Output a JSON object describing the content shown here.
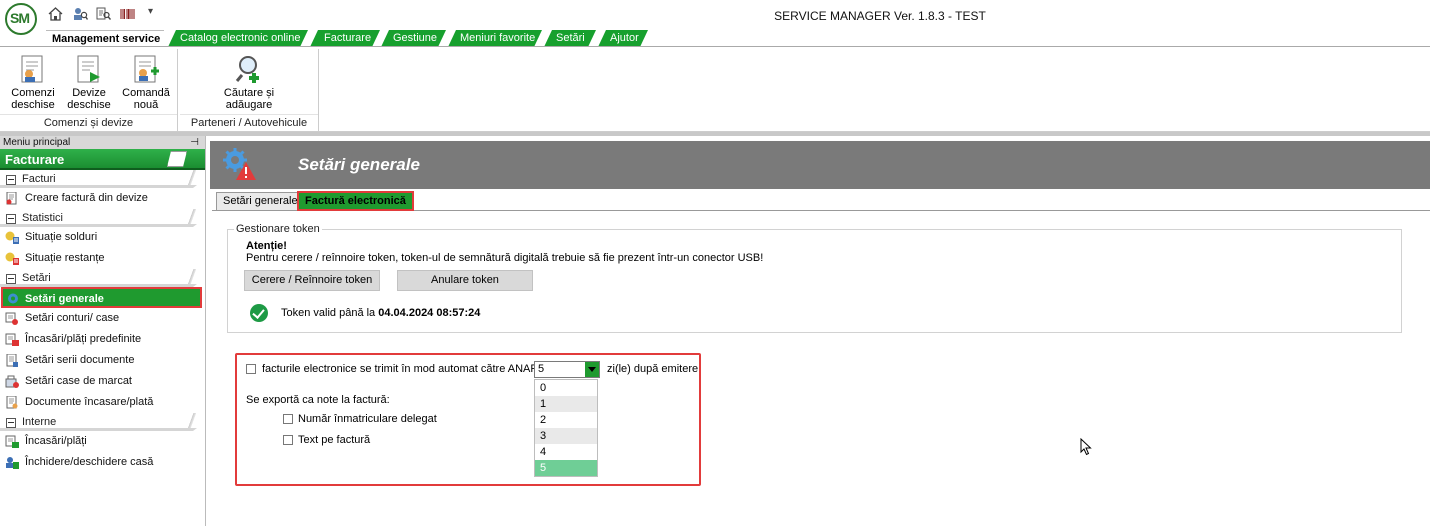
{
  "app": {
    "title": "SERVICE MANAGER Ver. 1.8.3 - TEST",
    "logo_text": "SM",
    "accent_color": "#1f9a2f"
  },
  "quick_access": {
    "icons": [
      "home-icon",
      "search-user-icon",
      "search-document-icon",
      "barcode-icon"
    ],
    "more": "▾"
  },
  "menu_tabs": [
    {
      "label": "Management service",
      "active": true
    },
    {
      "label": "Catalog electronic online",
      "active": false
    },
    {
      "label": "Facturare",
      "active": false
    },
    {
      "label": "Gestiune",
      "active": false
    },
    {
      "label": "Meniuri favorite",
      "active": false
    },
    {
      "label": "Setări",
      "active": false
    },
    {
      "label": "Ajutor",
      "active": false
    }
  ],
  "ribbon": {
    "groups": [
      {
        "label": "Comenzi și devize",
        "buttons": [
          {
            "line1": "Comenzi",
            "line2": "deschise"
          },
          {
            "line1": "Devize",
            "line2": "deschise"
          },
          {
            "line1": "Comandă",
            "line2": "nouă"
          }
        ]
      },
      {
        "label": "Parteneri / Autovehicule",
        "buttons": [
          {
            "line1": "Căutare și",
            "line2": "adăugare"
          }
        ]
      }
    ]
  },
  "left_panel": {
    "header": "Meniu principal",
    "pin": "ᵖ",
    "title": "Facturare",
    "sections": [
      {
        "label": "Facturi",
        "items": [
          "Creare factură din devize"
        ]
      },
      {
        "label": "Statistici",
        "items": [
          "Situație solduri",
          "Situație restanțe"
        ]
      },
      {
        "label": "Setări",
        "items": [
          "Setări generale",
          "Setări conturi/ case",
          "Încasări/plăți predefinite",
          "Setări serii documente",
          "Setări case de marcat",
          "Documente încasare/plată"
        ]
      },
      {
        "label": "Interne",
        "items": [
          "Încasări/plăți",
          "Închidere/deschidere casă"
        ]
      }
    ],
    "selected_item": "Setări generale"
  },
  "main": {
    "header_title": "Setări generale",
    "subtabs": [
      {
        "label": "Setări generale",
        "active": false
      },
      {
        "label": "Factură electronică",
        "active": true
      }
    ],
    "token_group": {
      "legend": "Gestionare token",
      "warning_title": "Atenție!",
      "warning_text": "Pentru cerere / reînnoire token, token-ul de semnătură digitală trebuie să fie prezent într-un conector USB!",
      "request_button": "Cerere / Reînnoire token",
      "cancel_button": "Anulare token",
      "status_prefix": "Token valid până la",
      "status_date": "04.04.2024 08:57:24"
    },
    "auto_send": {
      "checked": false,
      "label": "facturile electronice se trimit în mod automat către ANAF în",
      "days_value": "5",
      "days_suffix": "zi(le) după emitere",
      "options": [
        "0",
        "1",
        "2",
        "3",
        "4",
        "5"
      ],
      "selected_option": "5"
    },
    "export_notes": {
      "label": "Se exportă ca note la factură:",
      "option1_label": "Număr înmatriculare delegat",
      "option1_checked": false,
      "option2_label": "Text pe factură",
      "option2_checked": false
    }
  }
}
